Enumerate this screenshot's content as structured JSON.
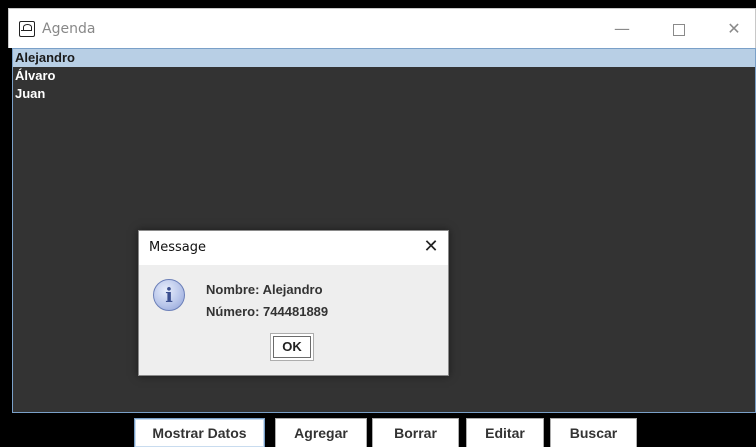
{
  "window": {
    "title": "Agenda",
    "controls": {
      "minimize": "—",
      "close": "✕"
    }
  },
  "list": {
    "items": [
      {
        "label": "Alejandro",
        "selected": true
      },
      {
        "label": "Álvaro",
        "selected": false
      },
      {
        "label": "Juan",
        "selected": false
      }
    ]
  },
  "buttons": {
    "mostrar": "Mostrar Datos",
    "agregar": "Agregar",
    "borrar": "Borrar",
    "editar": "Editar",
    "buscar": "Buscar"
  },
  "dialog": {
    "title": "Message",
    "close": "✕",
    "icon": "i",
    "line1": "Nombre: Alejandro",
    "line2": "Número: 744481889",
    "ok": "OK"
  },
  "colors": {
    "list_background": "#333333",
    "selection": "#b8cfe5",
    "dialog_background": "#eeeeee"
  }
}
